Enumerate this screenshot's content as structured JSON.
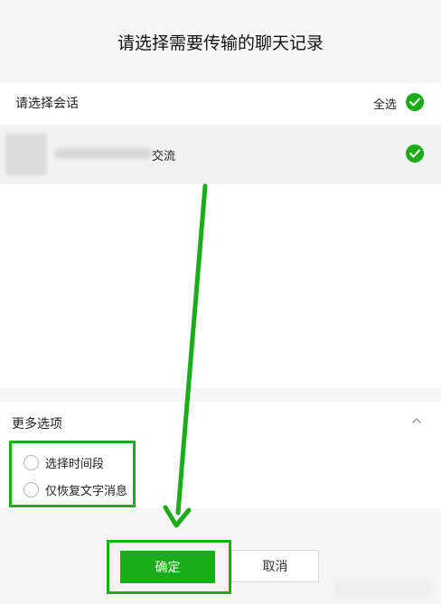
{
  "dialog": {
    "title": "请选择需要传输的聊天记录"
  },
  "chat_list": {
    "header_label": "请选择会话",
    "select_all_label": "全选",
    "items": [
      {
        "name_visible": "交流",
        "checked": true
      }
    ]
  },
  "more_options": {
    "title": "更多选项",
    "options": [
      {
        "label": "选择时间段",
        "checked": false
      },
      {
        "label": "仅恢复文字消息",
        "checked": false
      }
    ]
  },
  "buttons": {
    "confirm_label": "确定",
    "cancel_label": "取消"
  },
  "colors": {
    "accent": "#1aad19",
    "background": "#f7f7f7",
    "panel": "#ffffff"
  },
  "icons": [
    "check-icon",
    "chevron-up-icon",
    "radio-icon"
  ]
}
